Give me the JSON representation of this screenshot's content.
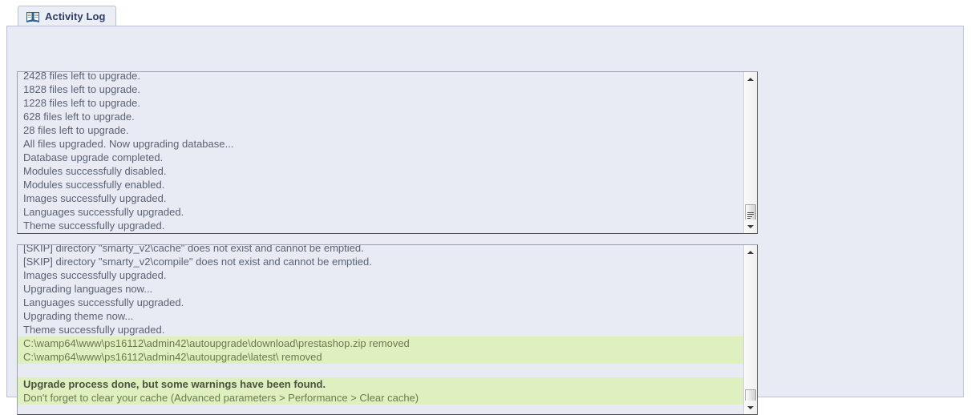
{
  "tab": {
    "label": "Activity Log",
    "icon": "book-icon"
  },
  "colors": {
    "page_background": "#ffffff",
    "panel_background": "#e8ebf4",
    "panel_border": "#b9bfd4",
    "log_text": "#5a6273",
    "highlight_background": "#dff0c0",
    "highlight_text": "#6b7a4e",
    "highlight_strong_text": "#4d5240",
    "tab_label": "#2e3c63",
    "scrollbar_track": "#f3f3f3",
    "scrollbar_thumb": "#e4e4e4"
  },
  "log_panel_1": {
    "name": "upgrade-log",
    "lines": [
      {
        "text": "2428 files left to upgrade.",
        "style": "normal"
      },
      {
        "text": "1828 files left to upgrade.",
        "style": "normal"
      },
      {
        "text": "1228 files left to upgrade.",
        "style": "normal"
      },
      {
        "text": "628 files left to upgrade.",
        "style": "normal"
      },
      {
        "text": "28 files left to upgrade.",
        "style": "normal"
      },
      {
        "text": "All files upgraded. Now upgrading database...",
        "style": "normal"
      },
      {
        "text": "Database upgrade completed.",
        "style": "normal"
      },
      {
        "text": "Modules successfully disabled.",
        "style": "normal"
      },
      {
        "text": "Modules successfully enabled.",
        "style": "normal"
      },
      {
        "text": "Images successfully upgraded.",
        "style": "normal"
      },
      {
        "text": "Languages successfully upgraded.",
        "style": "normal"
      },
      {
        "text": "Theme successfully upgraded.",
        "style": "normal"
      }
    ],
    "scrollbar": {
      "up_arrow": "scroll-up-arrow",
      "down_arrow": "scroll-down-arrow",
      "thumb_position": "near-bottom"
    }
  },
  "log_panel_2": {
    "name": "detailed-log",
    "lines": [
      {
        "text": "[SKIP] directory \"smarty_v2\\cache\" does not exist and cannot be emptied.",
        "style": "normal"
      },
      {
        "text": "[SKIP] directory \"smarty_v2\\compile\" does not exist and cannot be emptied.",
        "style": "normal"
      },
      {
        "text": "Images successfully upgraded.",
        "style": "normal"
      },
      {
        "text": "Upgrading languages now...",
        "style": "normal"
      },
      {
        "text": "Languages successfully upgraded.",
        "style": "normal"
      },
      {
        "text": "Upgrading theme now...",
        "style": "normal"
      },
      {
        "text": "Theme successfully upgraded.",
        "style": "normal"
      },
      {
        "text": "C:\\wamp64\\www\\ps16112\\admin42\\autoupgrade\\download\\prestashop.zip removed",
        "style": "highlight"
      },
      {
        "text": "C:\\wamp64\\www\\ps16112\\admin42\\autoupgrade\\latest\\ removed",
        "style": "highlight"
      },
      {
        "text": "",
        "style": "spacer"
      },
      {
        "text": "Upgrade process done, but some warnings have been found.",
        "style": "highlight-strong"
      },
      {
        "text": "Don't forget to clear your cache (Advanced parameters > Performance > Clear cache)",
        "style": "highlight"
      }
    ],
    "scrollbar": {
      "up_arrow": "scroll-up-arrow",
      "down_arrow": "scroll-down-arrow",
      "thumb_position": "bottom"
    }
  }
}
